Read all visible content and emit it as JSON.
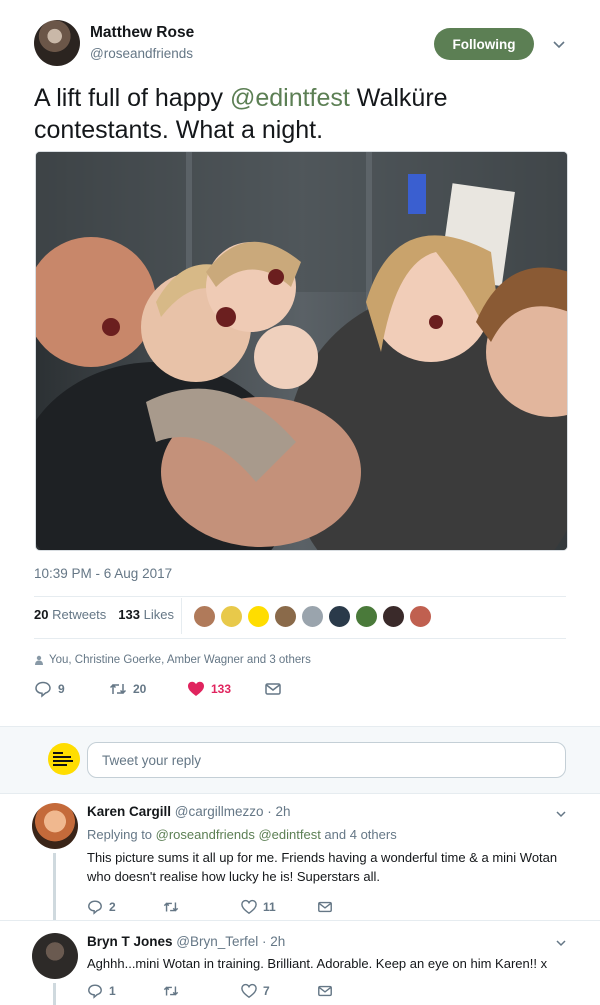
{
  "tweet": {
    "author_name": "Matthew Rose",
    "author_handle": "@roseandfriends",
    "follow_label": "Following",
    "text_before": "A lift full of happy ",
    "mention": "@edintfest",
    "text_after": " Walküre contestants. What a night.",
    "timestamp": "10:39 PM - 6 Aug 2017",
    "retweets_count": "20",
    "retweets_label": "Retweets",
    "likes_count": "133",
    "likes_label": "Likes",
    "social_context": "You, Christine Goerke, Amber Wagner and 3 others",
    "actions": {
      "reply_count": "9",
      "retweet_count": "20",
      "like_count": "133"
    },
    "liker_colors": [
      "#b07a5a",
      "#e8c94a",
      "#ffdd00",
      "#8a6a4a",
      "#9aa4ad",
      "#2a3a4a",
      "#4a7a3a",
      "#3a2a2a",
      "#c06050"
    ],
    "accent_color": "#5c7f54",
    "like_color": "#e0245e"
  },
  "reply_box": {
    "placeholder": "Tweet your reply"
  },
  "replies": [
    {
      "name": "Karen Cargill",
      "handle": "@cargillmezzo",
      "time": "· 2h",
      "replying_prefix": "Replying to ",
      "replying_mentions": "@roseandfriends @edintfest",
      "replying_suffix": " and 4 others",
      "text": "This picture sums it all up for me. Friends having a wonderful time & a mini Wotan who doesn't realise how lucky he is! Superstars all.",
      "reply_count": "2",
      "retweet_count": "",
      "like_count": "11"
    },
    {
      "name": "Bryn T Jones",
      "handle": "@Bryn_Terfel",
      "time": "· 2h",
      "text": "Aghhh...mini Wotan in training. Brilliant. Adorable. Keep an eye on him Karen!! x",
      "reply_count": "1",
      "retweet_count": "",
      "like_count": "7"
    }
  ]
}
